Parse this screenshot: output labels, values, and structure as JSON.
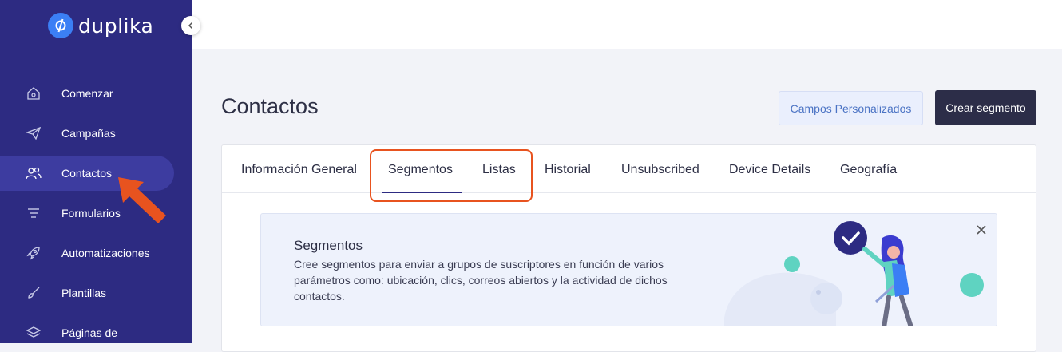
{
  "app": {
    "brand": "duplika"
  },
  "sidebar": {
    "items": [
      {
        "label": "Comenzar",
        "icon": "home-icon"
      },
      {
        "label": "Campañas",
        "icon": "paper-plane-icon"
      },
      {
        "label": "Contactos",
        "icon": "users-icon",
        "active": true
      },
      {
        "label": "Formularios",
        "icon": "lines-icon"
      },
      {
        "label": "Automatizaciones",
        "icon": "rocket-icon"
      },
      {
        "label": "Plantillas",
        "icon": "brush-icon"
      },
      {
        "label": "Páginas de",
        "icon": "layers-icon"
      }
    ]
  },
  "header": {
    "title": "Contactos",
    "secondary_button": "Campos Personalizados",
    "primary_button": "Crear segmento"
  },
  "tabs": [
    {
      "label": "Información General"
    },
    {
      "label": "Segmentos",
      "active": true
    },
    {
      "label": "Listas"
    },
    {
      "label": "Historial"
    },
    {
      "label": "Unsubscribed"
    },
    {
      "label": "Device Details"
    },
    {
      "label": "Geografía"
    }
  ],
  "banner": {
    "title": "Segmentos",
    "text": "Cree segmentos para enviar a grupos de suscriptores en función de varios parámetros como: ubicación, clics, correos abiertos y la actividad de dichos contactos."
  },
  "colors": {
    "sidebar": "#2d2b82",
    "accent": "#3b7ff5",
    "highlight": "#e8531f",
    "primary_button": "#2c2d48"
  }
}
